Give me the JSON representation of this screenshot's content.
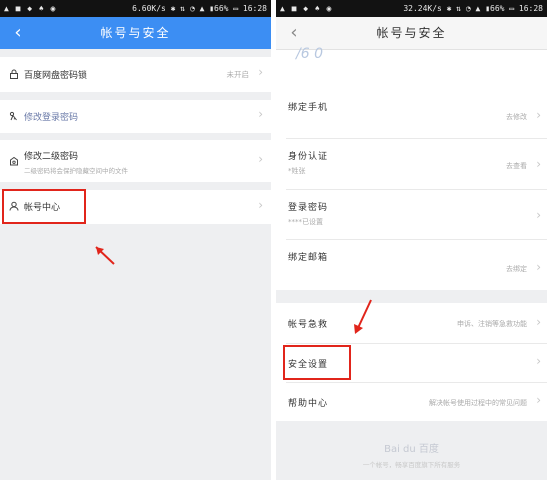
{
  "left": {
    "status": {
      "left": "▲ ■ ◆ ♠ ◉",
      "right": "6.60K/s ✱ ⇅ ◔ ▲ ▮66% ▭ 16:28"
    },
    "title": "帐号与安全",
    "rows": [
      {
        "label": "百度网盘密码锁",
        "value": "未开启",
        "icon": "lock-icon"
      },
      {
        "label": "修改登录密码",
        "value": "",
        "icon": "key-icon"
      },
      {
        "label": "修改二级密码",
        "sub": "二级密码将会保护隐藏空间中的文件",
        "value": "",
        "icon": "safe-icon"
      },
      {
        "label": "帐号中心",
        "value": "",
        "icon": "person-icon"
      }
    ]
  },
  "right": {
    "status": {
      "left": "▲ ■ ◆ ♠ ◉",
      "right": "32.24K/s ✱ ⇅ ◔ ▲ ▮66% ▭ 16:28"
    },
    "title": "帐号与安全",
    "header_fragment": "/6 0",
    "rows": [
      {
        "label": "绑定手机",
        "value": "去修改",
        "sub": ""
      },
      {
        "label": "身份认证",
        "value": "去查看",
        "sub": "*姓张"
      },
      {
        "label": "登录密码",
        "value": "",
        "sub": "****已设置"
      },
      {
        "label": "绑定邮箱",
        "value": "去绑定",
        "sub": ""
      }
    ],
    "rows2": [
      {
        "label": "帐号急救",
        "value": "申诉、注销等急救功能"
      },
      {
        "label": "安全设置",
        "value": ""
      },
      {
        "label": "帮助中心",
        "value": "解决帐号使用过程中的常见问题"
      }
    ],
    "footer_logo": "Bai du 百度",
    "footer_text": "一个帐号，畅享百度旗下所有服务"
  },
  "colors": {
    "accent": "#3c8ef3",
    "highlight": "#e1251b"
  }
}
